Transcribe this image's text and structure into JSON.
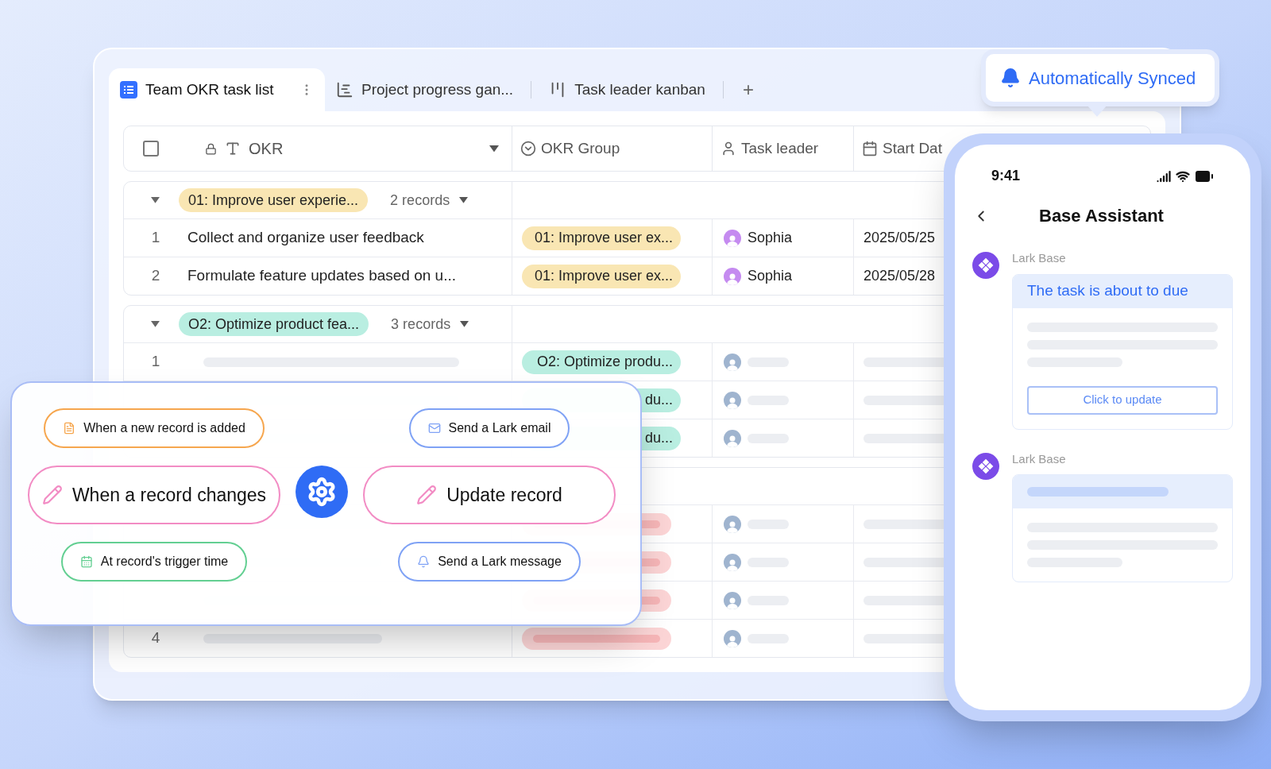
{
  "tabs": [
    {
      "label": "Team OKR task list",
      "selected": true
    },
    {
      "label": "Project progress gan...",
      "selected": false
    },
    {
      "label": "Task leader kanban",
      "selected": false
    }
  ],
  "add_tab": "+",
  "table": {
    "select_all": {
      "checked": false
    },
    "columns": [
      {
        "label": "OKR"
      },
      {
        "label": "OKR Group"
      },
      {
        "label": "Task leader"
      },
      {
        "label": "Start Dat"
      }
    ],
    "groups": [
      {
        "tag": "01: Improve user experie...",
        "count": "2 records",
        "color": "#f9e6b3",
        "rows": [
          {
            "num": "1",
            "okr": "Collect and organize user feedback",
            "tag": "01: Improve user ex...",
            "leader": "Sophia",
            "start": "2025/05/25"
          },
          {
            "num": "2",
            "okr": "Formulate feature updates based on u...",
            "tag": "01: Improve user ex...",
            "leader": "Sophia",
            "start": "2025/05/28"
          }
        ]
      },
      {
        "tag": "O2: Optimize product fea...",
        "count": "3 records",
        "color": "#b9eee1",
        "rows": [
          {
            "num": "1",
            "tag": "O2: Optimize produ..."
          },
          {
            "tag": "du..."
          },
          {
            "tag": "du..."
          }
        ]
      },
      {
        "color": "#fcd5d6",
        "rows": [
          {},
          {},
          {},
          {
            "num": "4"
          }
        ]
      }
    ]
  },
  "automation": {
    "triggers": [
      {
        "label": "When a new record is added",
        "kind": "note",
        "color": "#f6a64e"
      },
      {
        "label": "When a record changes",
        "kind": "pencil",
        "color": "#f28cc4"
      },
      {
        "label": "At record's trigger time",
        "kind": "calendar",
        "color": "#63cf92"
      }
    ],
    "actions": [
      {
        "label": "Send a Lark email",
        "kind": "mail",
        "color": "#7fa2f5"
      },
      {
        "label": "Update record",
        "kind": "pencil",
        "color": "#f28cc4"
      },
      {
        "label": "Send a Lark message",
        "kind": "bell",
        "color": "#7fa2f5"
      }
    ]
  },
  "sync_badge": "Automatically Synced",
  "phone": {
    "time": "9:41",
    "title": "Base Assistant",
    "messages": [
      {
        "sender": "Lark Base",
        "title": "The task is about to due",
        "button": "Click to update"
      },
      {
        "sender": "Lark Base"
      }
    ]
  }
}
